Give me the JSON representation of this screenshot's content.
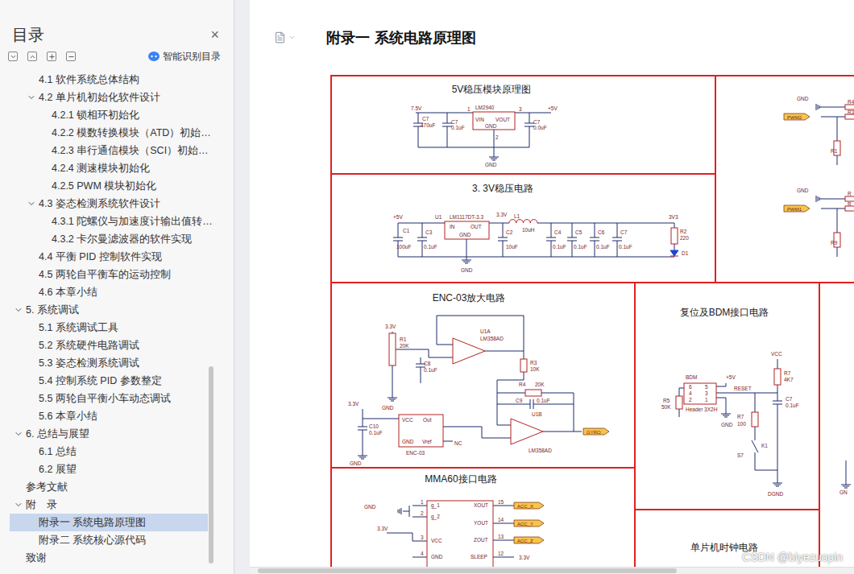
{
  "sidebar": {
    "title": "目录",
    "close": "×",
    "smart_button": "智能识别目录",
    "items": [
      {
        "label": "4.1 软件系统总体结构",
        "depth": 2,
        "expandable": false,
        "expanded": false,
        "selected": false
      },
      {
        "label": "4.2 单片机初始化软件设计",
        "depth": 2,
        "expandable": true,
        "expanded": true,
        "selected": false
      },
      {
        "label": "4.2.1 锁相环初始化",
        "depth": 3,
        "expandable": false,
        "expanded": false,
        "selected": false
      },
      {
        "label": "4.2.2 模数转换模块（ATD）初始…",
        "depth": 3,
        "expandable": false,
        "expanded": false,
        "selected": false
      },
      {
        "label": "4.2.3 串行通信模块（SCI）初始…",
        "depth": 3,
        "expandable": false,
        "expanded": false,
        "selected": false
      },
      {
        "label": "4.2.4 测速模块初始化",
        "depth": 3,
        "expandable": false,
        "expanded": false,
        "selected": false
      },
      {
        "label": "4.2.5 PWM 模块初始化",
        "depth": 3,
        "expandable": false,
        "expanded": false,
        "selected": false
      },
      {
        "label": "4.3 姿态检测系统软件设计",
        "depth": 2,
        "expandable": true,
        "expanded": true,
        "selected": false
      },
      {
        "label": "4.3.1 陀螺仪与加速度计输出值转…",
        "depth": 3,
        "expandable": false,
        "expanded": false,
        "selected": false
      },
      {
        "label": "4.3.2 卡尔曼滤波器的软件实现",
        "depth": 3,
        "expandable": false,
        "expanded": false,
        "selected": false
      },
      {
        "label": "4.4 平衡 PID 控制软件实现",
        "depth": 2,
        "expandable": false,
        "expanded": false,
        "selected": false
      },
      {
        "label": "4.5 两轮自平衡车的运动控制",
        "depth": 2,
        "expandable": false,
        "expanded": false,
        "selected": false
      },
      {
        "label": "4.6 本章小结",
        "depth": 2,
        "expandable": false,
        "expanded": false,
        "selected": false
      },
      {
        "label": "5. 系统调试",
        "depth": 1,
        "expandable": true,
        "expanded": true,
        "selected": false
      },
      {
        "label": "5.1 系统调试工具",
        "depth": 2,
        "expandable": false,
        "expanded": false,
        "selected": false
      },
      {
        "label": "5.2 系统硬件电路调试",
        "depth": 2,
        "expandable": false,
        "expanded": false,
        "selected": false
      },
      {
        "label": "5.3 姿态检测系统调试",
        "depth": 2,
        "expandable": false,
        "expanded": false,
        "selected": false
      },
      {
        "label": "5.4 控制系统 PID 参数整定",
        "depth": 2,
        "expandable": false,
        "expanded": false,
        "selected": false
      },
      {
        "label": "5.5 两轮自平衡小车动态调试",
        "depth": 2,
        "expandable": false,
        "expanded": false,
        "selected": false
      },
      {
        "label": "5.6 本章小结",
        "depth": 2,
        "expandable": false,
        "expanded": false,
        "selected": false
      },
      {
        "label": "6. 总结与展望",
        "depth": 1,
        "expandable": true,
        "expanded": true,
        "selected": false
      },
      {
        "label": "6.1 总结",
        "depth": 2,
        "expandable": false,
        "expanded": false,
        "selected": false
      },
      {
        "label": "6.2 展望",
        "depth": 2,
        "expandable": false,
        "expanded": false,
        "selected": false
      },
      {
        "label": "参考文献",
        "depth": 1,
        "expandable": false,
        "expanded": false,
        "selected": false
      },
      {
        "label": "附　录",
        "depth": 1,
        "expandable": true,
        "expanded": true,
        "selected": false
      },
      {
        "label": "附录一 系统电路原理图",
        "depth": 2,
        "expandable": false,
        "expanded": false,
        "selected": true
      },
      {
        "label": "附录二 系统核心源代码",
        "depth": 2,
        "expandable": false,
        "expanded": false,
        "selected": false
      },
      {
        "label": "致谢",
        "depth": 1,
        "expandable": false,
        "expanded": false,
        "selected": false
      }
    ]
  },
  "document": {
    "heading": "附录一 系统电路原理图",
    "figure": {
      "panels": [
        {
          "title": "5V稳压模块原理图",
          "labels": [
            "7.5V",
            "LM2940",
            "VIN",
            "VOUT",
            "GND",
            "+5V",
            "C7",
            "470uF",
            "C7",
            "0.1uF",
            "C7",
            "0.0uF",
            "GND",
            "1",
            "3",
            "2"
          ],
          "tags": []
        },
        {
          "title": "3. 3V稳压电路",
          "labels": [
            "+5V",
            "U1",
            "LM1117DT-3.3",
            "IN",
            "OUT",
            "GND",
            "3.3V",
            "L1",
            "10uH",
            "3V3",
            "R2",
            "220",
            "D1",
            "C1",
            "100uF",
            "C3",
            "0.1uF",
            "C2",
            "10uF",
            "C4",
            "0.1uF",
            "C5",
            "0.1uF",
            "C6",
            "0.1uF",
            "C7",
            "0.1uF",
            "GND"
          ],
          "tags": []
        },
        {
          "title": "",
          "labels": [
            "GND",
            "R4",
            "R3",
            "R1",
            "GND",
            "R",
            "R",
            "R9"
          ],
          "tags": [
            "PWM2",
            "PWM1"
          ]
        },
        {
          "title": "ENC-03放大电路",
          "labels": [
            "3.3V",
            "R1",
            "20K",
            "C8",
            "0.1uF",
            "GND",
            "U1A",
            "LM358AD",
            "R3",
            "10K",
            "R4",
            "20K",
            "C9",
            "0.1uF",
            "U1B",
            "LM358AD",
            "3.3V",
            "C10",
            "0.1uF",
            "VCC",
            "Out",
            "GND",
            "Vref",
            "ENC-03",
            "NC",
            "GND"
          ],
          "tags": [
            "GYRO"
          ]
        },
        {
          "title": "MMA60接口电路",
          "labels": [
            "GND",
            "3.3V",
            "1",
            "2",
            "3",
            "4",
            "g_1",
            "g_2",
            "VCC",
            "GND",
            "XOUT",
            "YOUT",
            "ZOUT",
            "SLEEP",
            "15",
            "14",
            "13",
            "12",
            "3.3V"
          ],
          "tags": [
            "ACC_X",
            "ACC_Y",
            "ACC_Z"
          ]
        },
        {
          "title": "复位及BDM接口电路",
          "labels": [
            "VCC",
            "R7",
            "4K7",
            "BDM",
            "+5V",
            "6",
            "5",
            "4",
            "3",
            "2",
            "1",
            "RESET",
            "R5",
            "50K",
            "Header 3X2H",
            "GND",
            "R7",
            "100",
            "C7",
            "0.1uF",
            "K1",
            "S7",
            "DGND"
          ],
          "tags": []
        },
        {
          "title": "单片机时钟电路",
          "labels": [],
          "tags": []
        },
        {
          "title": "",
          "labels": [
            "GN"
          ],
          "tags": []
        }
      ]
    }
  },
  "watermark": "CSDN @biyezuopin"
}
